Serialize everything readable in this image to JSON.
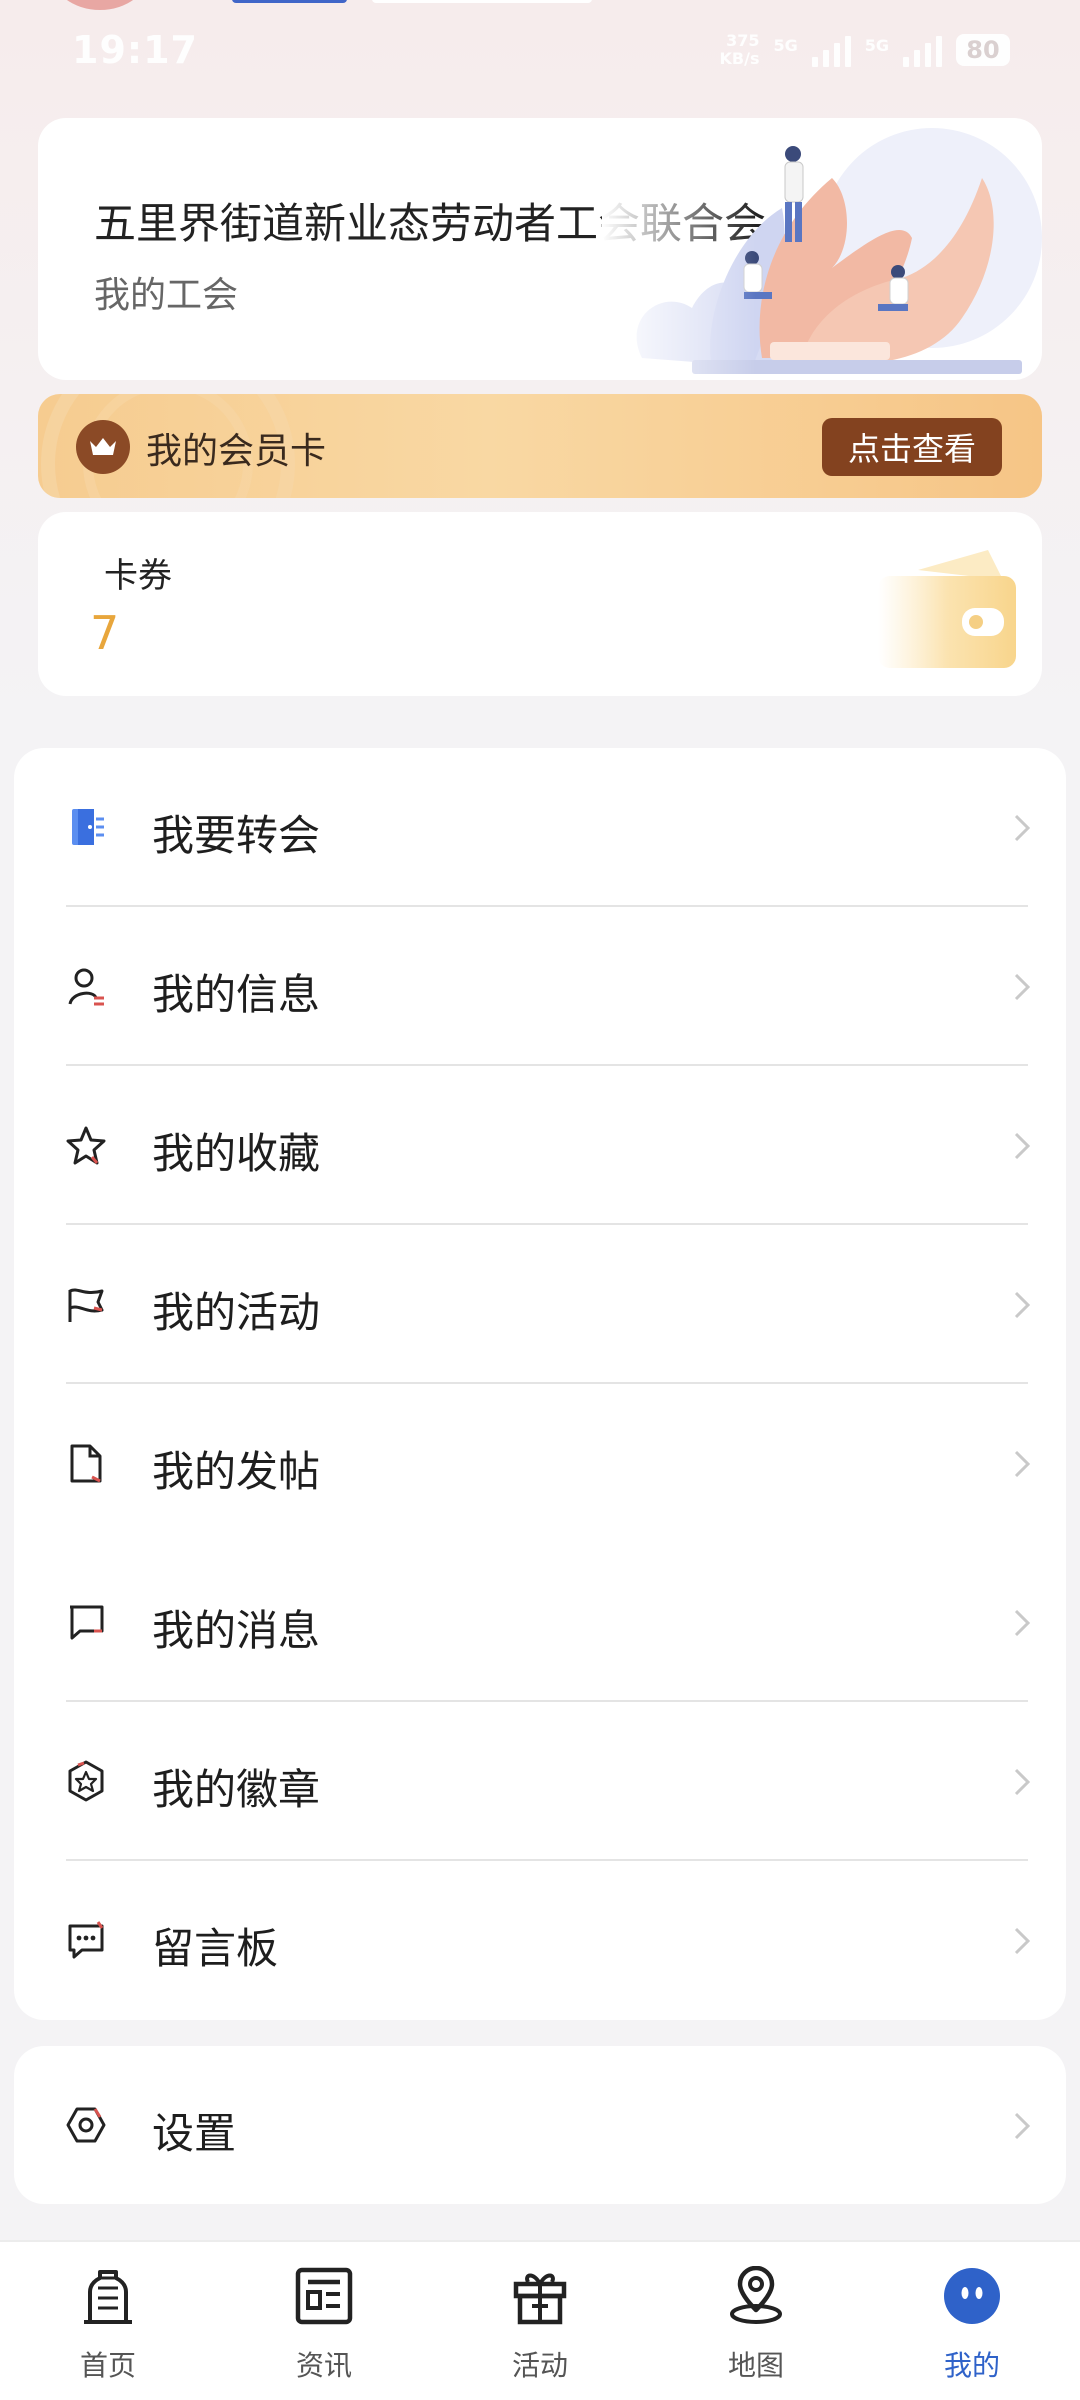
{
  "status_bar": {
    "time": "19:17",
    "net_speed_value": "375",
    "net_speed_unit": "KB/s",
    "network_1": "5G",
    "network_2": "5G",
    "battery": "80"
  },
  "union": {
    "name": "五里界街道新业态劳动者工会联合会",
    "subtitle": "我的工会"
  },
  "member_card": {
    "label": "我的会员卡",
    "button": "点击查看"
  },
  "coupons": {
    "label": "卡券",
    "count": "7"
  },
  "menu": {
    "items": [
      {
        "label": "我要转会",
        "icon": "transfer-door-icon"
      },
      {
        "label": "我的信息",
        "icon": "user-info-icon"
      },
      {
        "label": "我的收藏",
        "icon": "star-icon"
      },
      {
        "label": "我的活动",
        "icon": "flag-icon"
      },
      {
        "label": "我的发帖",
        "icon": "document-icon"
      },
      {
        "label": "我的消息",
        "icon": "message-icon"
      },
      {
        "label": "我的徽章",
        "icon": "badge-icon"
      },
      {
        "label": "留言板",
        "icon": "comment-board-icon"
      }
    ]
  },
  "settings": {
    "label": "设置",
    "icon": "settings-hexagon-icon"
  },
  "tab_bar": {
    "tabs": [
      {
        "label": "首页",
        "icon": "home-building-icon"
      },
      {
        "label": "资讯",
        "icon": "news-icon"
      },
      {
        "label": "活动",
        "icon": "gift-icon"
      },
      {
        "label": "地图",
        "icon": "map-pin-icon"
      },
      {
        "label": "我的",
        "icon": "profile-face-icon",
        "active": true
      }
    ]
  },
  "colors": {
    "accent": "#2f62c9",
    "member_button": "#83421f",
    "coupon_count": "#e8a63c"
  }
}
